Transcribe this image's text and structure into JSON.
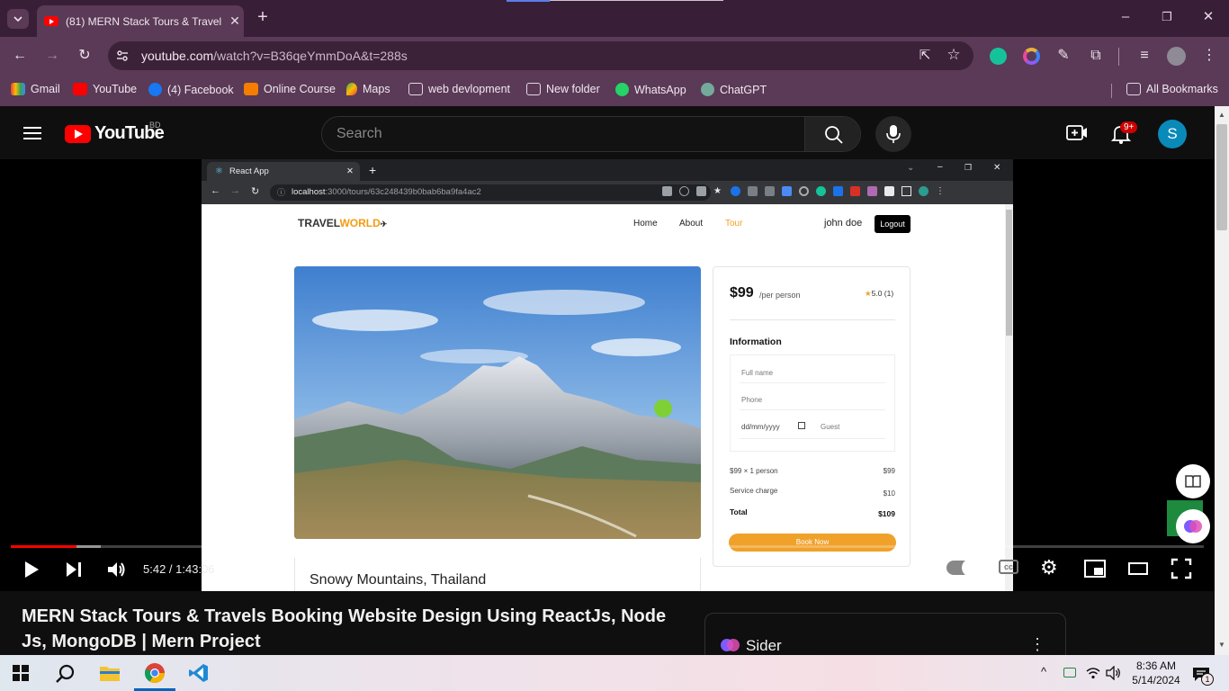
{
  "browser": {
    "tab_title": "(81) MERN Stack Tours & Travel",
    "url_host": "youtube.com",
    "url_path": "/watch?v=B36qeYmmDoA&t=288s",
    "bookmarks": [
      {
        "label": "Gmail",
        "icon": "gmail-icon"
      },
      {
        "label": "YouTube",
        "icon": "youtube-icon"
      },
      {
        "label": "(4) Facebook",
        "icon": "facebook-icon"
      },
      {
        "label": "Online Course",
        "icon": "blogger-icon"
      },
      {
        "label": "Maps",
        "icon": "maps-icon"
      },
      {
        "label": "web devlopment",
        "icon": "folder-icon"
      },
      {
        "label": "New folder",
        "icon": "folder-icon"
      },
      {
        "label": "WhatsApp",
        "icon": "whatsapp-icon"
      },
      {
        "label": "ChatGPT",
        "icon": "chatgpt-icon"
      }
    ],
    "all_bookmarks": "All Bookmarks"
  },
  "youtube": {
    "country": "BD",
    "search_placeholder": "Search",
    "notification_count": "9+",
    "avatar_letter": "S",
    "logo_text": "YouTube"
  },
  "video": {
    "time": "5:42 / 1:43:06",
    "progress_fraction": 0.0553,
    "title": "MERN Stack Tours & Travels Booking Website Design Using ReactJs, Node Js, MongoDB | Mern Project"
  },
  "inner_browser": {
    "tab_title": "React App",
    "url_host": "localhost",
    "url_rest": ":3000/tours/63c248439b0bab6ba9fa4ac2"
  },
  "site": {
    "logo_main": "TRAVEL",
    "logo_accent": "WORLD",
    "nav": [
      "Home",
      "About",
      "Tour"
    ],
    "user": "john doe",
    "logout": "Logout",
    "price": "$99",
    "price_unit": "/per person",
    "rating": "5.0 (1)",
    "info_title": "Information",
    "fields": {
      "full_name": "Full name",
      "phone": "Phone",
      "date": "dd/mm/yyyy",
      "guest": "Guest"
    },
    "fees": [
      {
        "label": "$99 × 1 person",
        "value": "$99"
      },
      {
        "label": "Service charge",
        "value": "$10"
      }
    ],
    "total_label": "Total",
    "total_value": "$109",
    "book_button": "Book Now",
    "tour_title": "Snowy Mountains, Thailand"
  },
  "sider": {
    "label": "Sider"
  },
  "taskbar": {
    "time": "8:36 AM",
    "date": "5/14/2024",
    "notif_count": "1"
  },
  "colors": {
    "yt_red": "#ff0000",
    "chrome_frame": "#5a3a57",
    "site_accent": "#f0a12a"
  }
}
